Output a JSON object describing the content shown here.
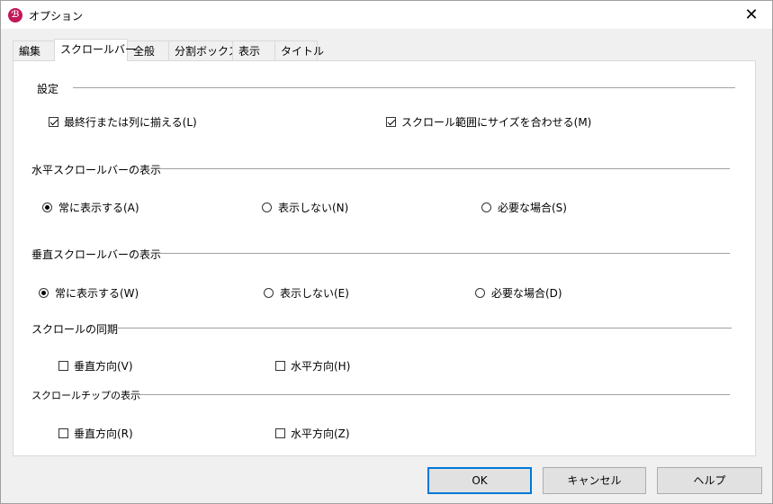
{
  "window": {
    "title": "オプション",
    "app_icon": "ℬ",
    "close_icon": "✕"
  },
  "tabs": [
    "編集",
    "スクロールバー",
    "全般",
    "分割ボックス",
    "表示",
    "タイトル"
  ],
  "active_tab": "スクロールバー",
  "settings": {
    "label": "設定",
    "align_last_line": {
      "label": "最終行または列に揃える(L)",
      "checked": true
    },
    "fit_size": {
      "label": "スクロール範囲にサイズを合わせる(M)",
      "checked": true
    }
  },
  "horizontal_scrollbar": {
    "label": "水平スクロールバーの表示",
    "options": [
      "常に表示する(A)",
      "表示しない(N)",
      "必要な場合(S)"
    ],
    "selected": "常に表示する(A)"
  },
  "vertical_scrollbar": {
    "label": "垂直スクロールバーの表示",
    "options": [
      "常に表示する(W)",
      "表示しない(E)",
      "必要な場合(D)"
    ],
    "selected": "常に表示する(W)"
  },
  "scroll_sync": {
    "label": "スクロールの同期",
    "vertical": {
      "label": "垂直方向(V)",
      "checked": false
    },
    "horizontal": {
      "label": "水平方向(H)",
      "checked": false
    }
  },
  "scroll_tip": {
    "label": "スクロールチップの表示",
    "vertical": {
      "label": "垂直方向(R)",
      "checked": false
    },
    "horizontal": {
      "label": "水平方向(Z)",
      "checked": false
    }
  },
  "buttons": {
    "ok": "OK",
    "cancel": "キャンセル",
    "help": "ヘルプ"
  }
}
